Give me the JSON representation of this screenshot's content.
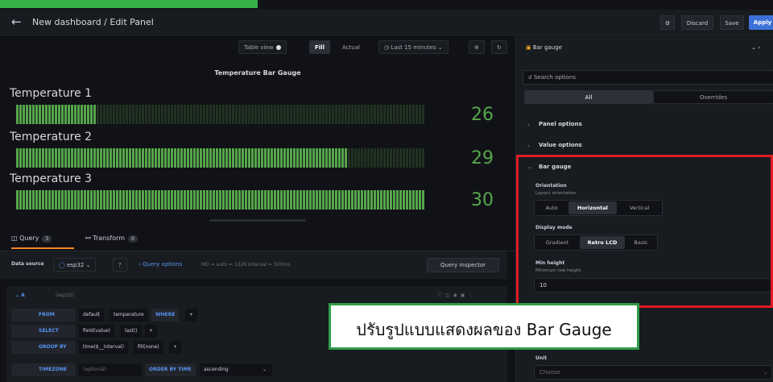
{
  "header": {
    "back_icon": "arrow-left-icon",
    "title": "New dashboard / Edit Panel",
    "discard": "Discard",
    "save": "Save",
    "apply": "Apply"
  },
  "toolbar": {
    "table_view": "Table view",
    "fill": "Fill",
    "actual": "Actual",
    "time_range": "Last 15 minutes"
  },
  "panel": {
    "title": "Temperature Bar Gauge",
    "gauges": [
      {
        "label": "Temperature 1",
        "value": "26",
        "fill": 0.2
      },
      {
        "label": "Temperature 2",
        "value": "29",
        "fill": 0.81
      },
      {
        "label": "Temperature 3",
        "value": "30",
        "fill": 1.0
      }
    ],
    "gauge_color": "#56a64b"
  },
  "query": {
    "tab_query": "Query",
    "tab_query_count": "3",
    "tab_transform": "Transform",
    "tab_transform_count": "0",
    "data_source_label": "Data source",
    "data_source": "esp32",
    "query_options": "Query options",
    "query_meta": "MD = auto = 1326   Interval = 500ms",
    "inspector": "Query inspector",
    "row_name": "A",
    "row_source": "(esp32)",
    "rows": {
      "from": {
        "kw": "FROM",
        "a": "default",
        "b": "temperature",
        "c": "WHERE",
        "d": "+"
      },
      "select": {
        "kw": "SELECT",
        "a": "field(value)",
        "b": "last()",
        "c": "+"
      },
      "group": {
        "kw": "GROUP BY",
        "a": "time($__interval)",
        "b": "fill(none)",
        "c": "+"
      },
      "timezone": {
        "kw": "TIMEZONE",
        "a": "(optional)",
        "b": "ORDER BY TIME",
        "c": "ascending"
      }
    }
  },
  "sidebar": {
    "viz": "Bar gauge",
    "search_placeholder": "Search options",
    "tab_all": "All",
    "tab_overrides": "Overrides",
    "panel_options": "Panel options",
    "value_options": "Value options",
    "bar_gauge": "Bar gauge",
    "orientation": "Orientation",
    "orientation_sub": "Layout orientation",
    "orientation_opts": [
      "Auto",
      "Horizontal",
      "Vertical"
    ],
    "display_mode": "Display mode",
    "display_opts": [
      "Gradient",
      "Retro LCD",
      "Basic"
    ],
    "min_height": "Min height",
    "min_height_sub": "Minimum row height",
    "min_height_value": "10",
    "unit": "Unit",
    "unit_placeholder": "Choose"
  },
  "callout": {
    "text": "ปรับรูปแบบแสดงผลของ Bar Gauge"
  }
}
